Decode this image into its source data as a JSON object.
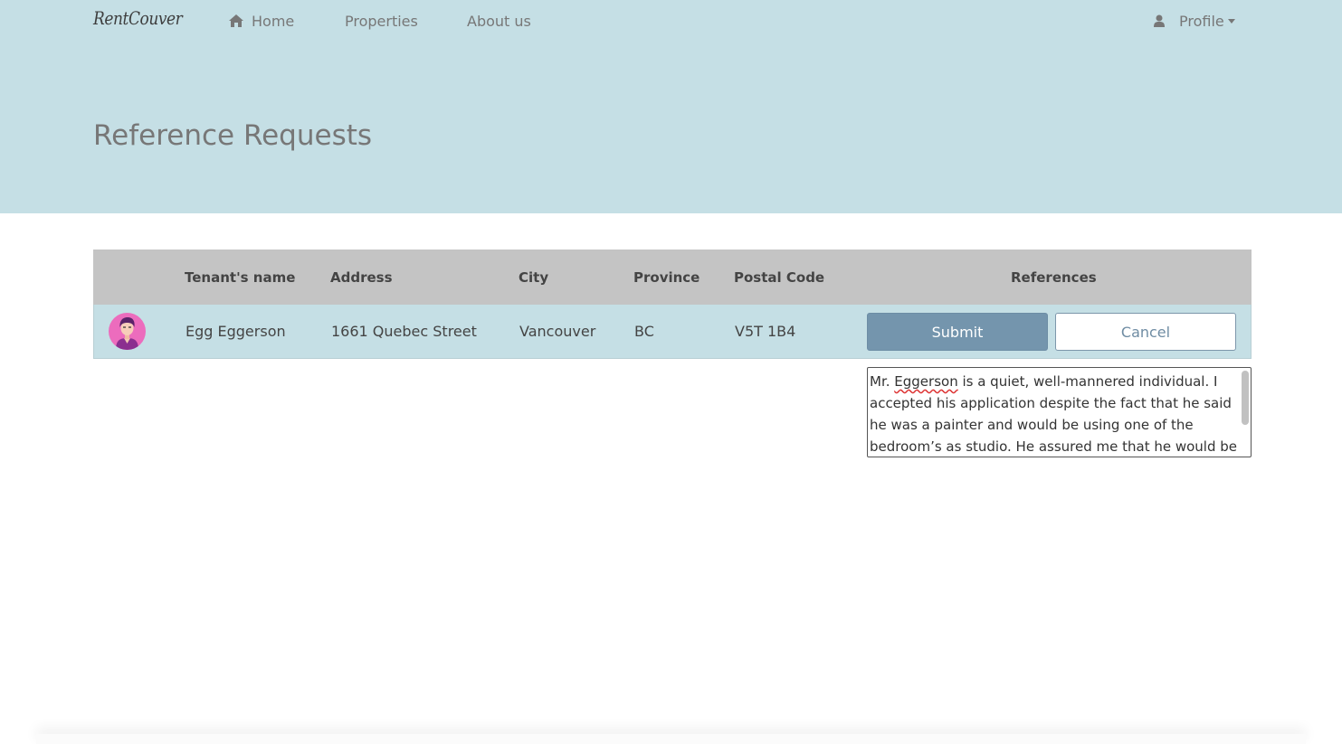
{
  "brand": "RentCouver",
  "nav": {
    "home": "Home",
    "properties": "Properties",
    "about": "About us",
    "profile": "Profile"
  },
  "page_title": "Reference Requests",
  "table": {
    "headers": {
      "name": "Tenant's name",
      "address": "Address",
      "city": "City",
      "province": "Province",
      "postal": "Postal Code",
      "references": "References"
    },
    "rows": [
      {
        "name": "Egg Eggerson",
        "address": "1661 Quebec Street",
        "city": "Vancouver",
        "province": "BC",
        "postal": "V5T 1B4",
        "submit": "Submit",
        "cancel": "Cancel"
      }
    ]
  },
  "reference": {
    "prefix": "Mr. ",
    "misspelled": "Eggerson",
    "text": " is a quiet, well-mannered individual. I accepted his application despite the fact that he said he was a painter and would be using one of the bedroom’s as studio. He assured me that he would be very careful"
  },
  "colors": {
    "hero_bg": "#c5dfe5",
    "header_bg": "#c4c4c4",
    "submit_bg": "#7495ad",
    "avatar_bg": "#ec6cbd"
  },
  "icons": [
    "home-icon",
    "user-icon",
    "caret-down-icon"
  ]
}
